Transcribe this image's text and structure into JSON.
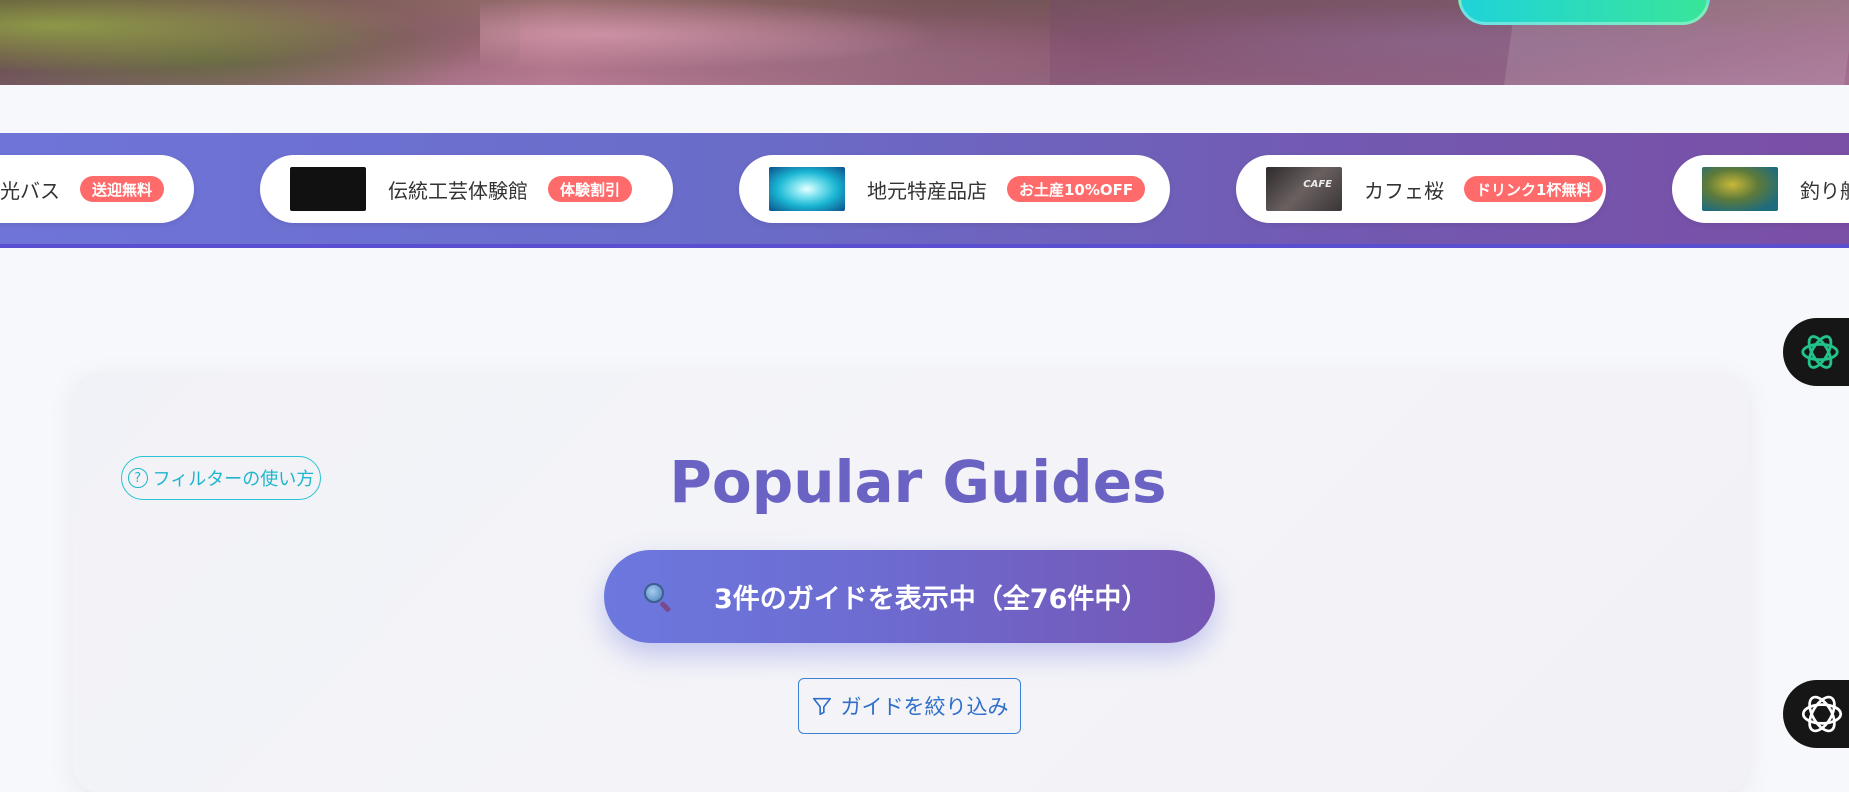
{
  "sponsors": [
    {
      "name": "光バス",
      "badge": "送迎無料"
    },
    {
      "name": "伝統工芸体験館",
      "badge": "体験割引"
    },
    {
      "name": "地元特産品店",
      "badge": "お土産10%OFF"
    },
    {
      "name": "カフェ桜",
      "badge": "ドリンク1杯無料"
    },
    {
      "name": "釣り船",
      "badge": ""
    }
  ],
  "main": {
    "filter_help_label": "フィルターの使い方",
    "title": "Popular Guides",
    "count_text": "3件のガイドを表示中（全76件中）",
    "filter_button_label": "ガイドを絞り込み"
  },
  "colors": {
    "accent": "#6a63c4",
    "badge": "#ff6b6b",
    "teal": "#1fb6cc",
    "filter_blue": "#2f6fc9"
  }
}
